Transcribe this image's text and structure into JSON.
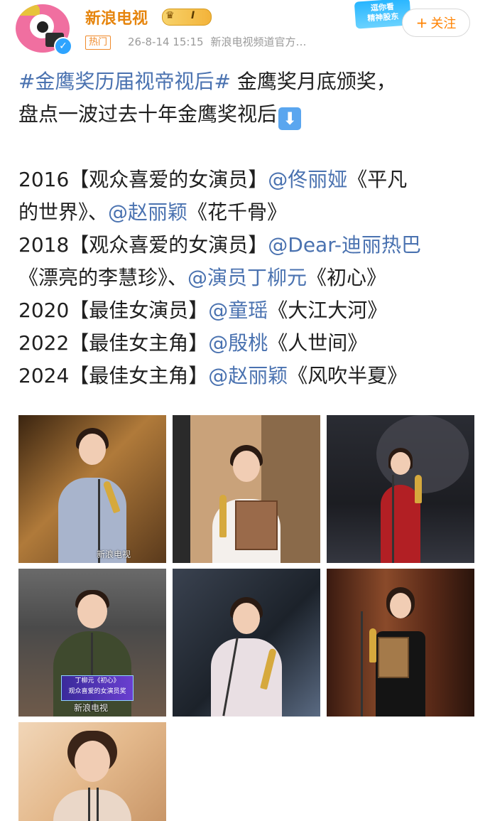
{
  "post": {
    "author": "新浪电视",
    "vip_level": "I",
    "hot_tag": "热门",
    "timestamp": "26-8-14 15:15",
    "source": "新浪电视频道官方…",
    "follow_label": "关注",
    "badge_text_1": "逗你看",
    "badge_text_2": "精神股东"
  },
  "content": {
    "hashtag": "#金鹰奖历届视帝视后#",
    "intro_1": " 金鹰奖月底颁奖，",
    "intro_2": "盘点一波过去十年金鹰奖视后",
    "entries": [
      {
        "year_award": "2016【观众喜爱的女演员】",
        "mention": "@佟丽娅",
        "work": "《平凡"
      },
      {
        "cont": "的世界》、",
        "mention": "@赵丽颖",
        "work": "《花千骨》"
      },
      {
        "year_award": "2018【观众喜爱的女演员】",
        "mention": "@Dear-迪丽热巴"
      },
      {
        "work": "《漂亮的李慧珍》、",
        "mention": "@演员丁柳元",
        "work2": "《初心》"
      },
      {
        "year_award": "2020【最佳女演员】",
        "mention": "@童瑶",
        "work": "《大江大河》"
      },
      {
        "year_award": "2022【最佳女主角】",
        "mention": "@殷桃",
        "work": "《人世间》"
      },
      {
        "year_award": "2024【最佳女主角】",
        "mention": "@赵丽颖",
        "work": "《风吹半夏》"
      }
    ]
  },
  "images": {
    "watermark": "新浪电视",
    "caption_strip_1": "丁柳元《初心》",
    "caption_strip_2": "观众喜爱的女演员奖"
  },
  "colors": {
    "link": "#4a72b0",
    "author": "#e6850e",
    "follow": "#ff8200",
    "meta": "#9a9a9a"
  }
}
